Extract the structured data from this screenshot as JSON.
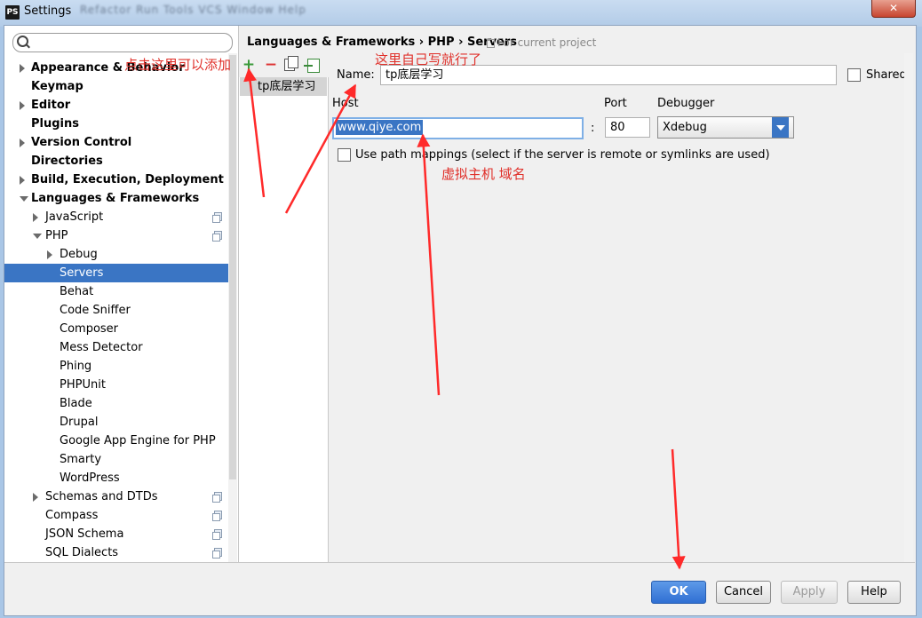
{
  "window": {
    "app_icon": "PS",
    "title": "Settings",
    "blurred_menu": "Refactor  Run  Tools  VCS  Window  Help"
  },
  "breadcrumb": {
    "text": "Languages & Frameworks › PHP › Servers",
    "scope": "For current project"
  },
  "tree": [
    {
      "label": "Appearance & Behavior",
      "level": 0,
      "arrow": "right",
      "bold": true
    },
    {
      "label": "Keymap",
      "level": 0,
      "arrow": "none",
      "bold": true
    },
    {
      "label": "Editor",
      "level": 0,
      "arrow": "right",
      "bold": true
    },
    {
      "label": "Plugins",
      "level": 0,
      "arrow": "none",
      "bold": true
    },
    {
      "label": "Version Control",
      "level": 0,
      "arrow": "right",
      "bold": true
    },
    {
      "label": "Directories",
      "level": 0,
      "arrow": "none",
      "bold": true
    },
    {
      "label": "Build, Execution, Deployment",
      "level": 0,
      "arrow": "right",
      "bold": true
    },
    {
      "label": "Languages & Frameworks",
      "level": 0,
      "arrow": "down",
      "bold": true
    },
    {
      "label": "JavaScript",
      "level": 1,
      "arrow": "right",
      "project": true
    },
    {
      "label": "PHP",
      "level": 1,
      "arrow": "down",
      "project": true
    },
    {
      "label": "Debug",
      "level": 2,
      "arrow": "right"
    },
    {
      "label": "Servers",
      "level": 3,
      "arrow": "none",
      "selected": true
    },
    {
      "label": "Behat",
      "level": 3,
      "arrow": "none"
    },
    {
      "label": "Code Sniffer",
      "level": 3,
      "arrow": "none"
    },
    {
      "label": "Composer",
      "level": 3,
      "arrow": "none"
    },
    {
      "label": "Mess Detector",
      "level": 3,
      "arrow": "none"
    },
    {
      "label": "Phing",
      "level": 3,
      "arrow": "none"
    },
    {
      "label": "PHPUnit",
      "level": 3,
      "arrow": "none"
    },
    {
      "label": "Blade",
      "level": 3,
      "arrow": "none"
    },
    {
      "label": "Drupal",
      "level": 3,
      "arrow": "none"
    },
    {
      "label": "Google App Engine for PHP",
      "level": 3,
      "arrow": "none"
    },
    {
      "label": "Smarty",
      "level": 3,
      "arrow": "none"
    },
    {
      "label": "WordPress",
      "level": 3,
      "arrow": "none"
    },
    {
      "label": "Schemas and DTDs",
      "level": 1,
      "arrow": "right",
      "project": true
    },
    {
      "label": "Compass",
      "level": 1,
      "arrow": "none",
      "project": true
    },
    {
      "label": "JSON Schema",
      "level": 1,
      "arrow": "none",
      "project": true
    },
    {
      "label": "SQL Dialects",
      "level": 1,
      "arrow": "none",
      "project": true
    }
  ],
  "servers": {
    "items": [
      "tp底层学习"
    ]
  },
  "form": {
    "name_label": "Name:",
    "name_value": "tp底层学习",
    "shared_label": "Shared",
    "host_label": "Host",
    "host_value": "www.qiye.com",
    "colon": ":",
    "port_label": "Port",
    "port_value": "80",
    "debugger_label": "Debugger",
    "debugger_value": "Xdebug",
    "path_mappings_label": "Use path mappings (select if the server is remote or symlinks are used)"
  },
  "buttons": {
    "ok": "OK",
    "cancel": "Cancel",
    "apply": "Apply",
    "help": "Help"
  },
  "annotations": {
    "add_hint": "点击这里可以添加",
    "name_hint": "这里自己写就行了",
    "host_hint": "虚拟主机 域名",
    "color": "#e0302a"
  }
}
